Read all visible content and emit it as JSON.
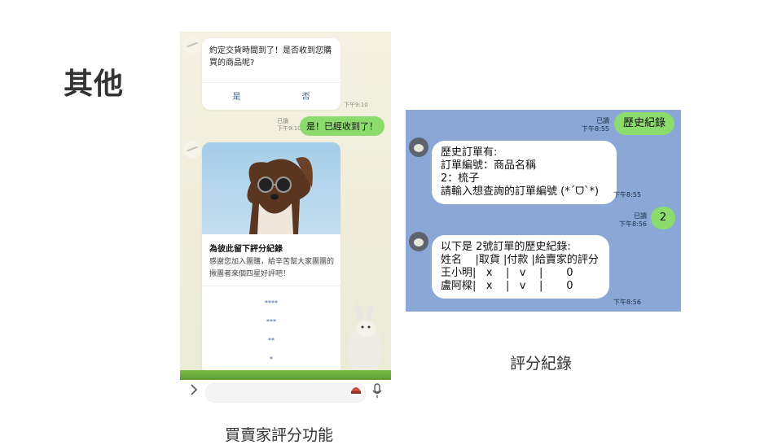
{
  "slide": {
    "title": "其他",
    "caption_left": "買賣家評分功能",
    "caption_right": "評分紀錄"
  },
  "left_chat": {
    "question": {
      "text": "約定交貨時間到了！是否收到您購買的商品呢?",
      "yes_label": "是",
      "no_label": "否",
      "time": "下午9:10"
    },
    "reply": {
      "read": "已讀",
      "time": "下午9:10",
      "text": "是！已經收到了！"
    },
    "rating_card": {
      "title": "為彼此留下評分紀錄",
      "description": "感謝您加入團購，給辛苦幫大家團團的揪團者來個四星好評吧！",
      "options": [
        "****",
        "***",
        "**",
        "*"
      ]
    },
    "icons": {
      "expand": "chevron-right-icon",
      "mic": "microphone-icon",
      "sticker": "sticker-icon"
    }
  },
  "right_chat": {
    "messages": [
      {
        "side": "user",
        "read": "已讀",
        "time": "下午8:55",
        "text": "歷史紀錄"
      },
      {
        "side": "bot",
        "time": "下午8:55",
        "lines": [
          "歷史訂單有:",
          "訂單編號：商品名稱",
          "2：梳子",
          "請輸入想查詢的訂單編號 (*ˊᗜˋ*)"
        ]
      },
      {
        "side": "user",
        "read": "已讀",
        "time": "下午8:56",
        "text": "2"
      },
      {
        "side": "bot",
        "time": "下午8:56",
        "lines": [
          "以下是 2號訂單的歷史紀錄:",
          "姓名    |取貨 |付款 |給賣家的評分",
          "王小明|   x    |   v    |       0",
          "盧阿樑|   x    |   v    |       0"
        ]
      }
    ]
  },
  "colors": {
    "green_bubble": "#8bdc6c",
    "right_chat_bg": "#8aa7d6",
    "link_blue": "#3b5f93"
  }
}
